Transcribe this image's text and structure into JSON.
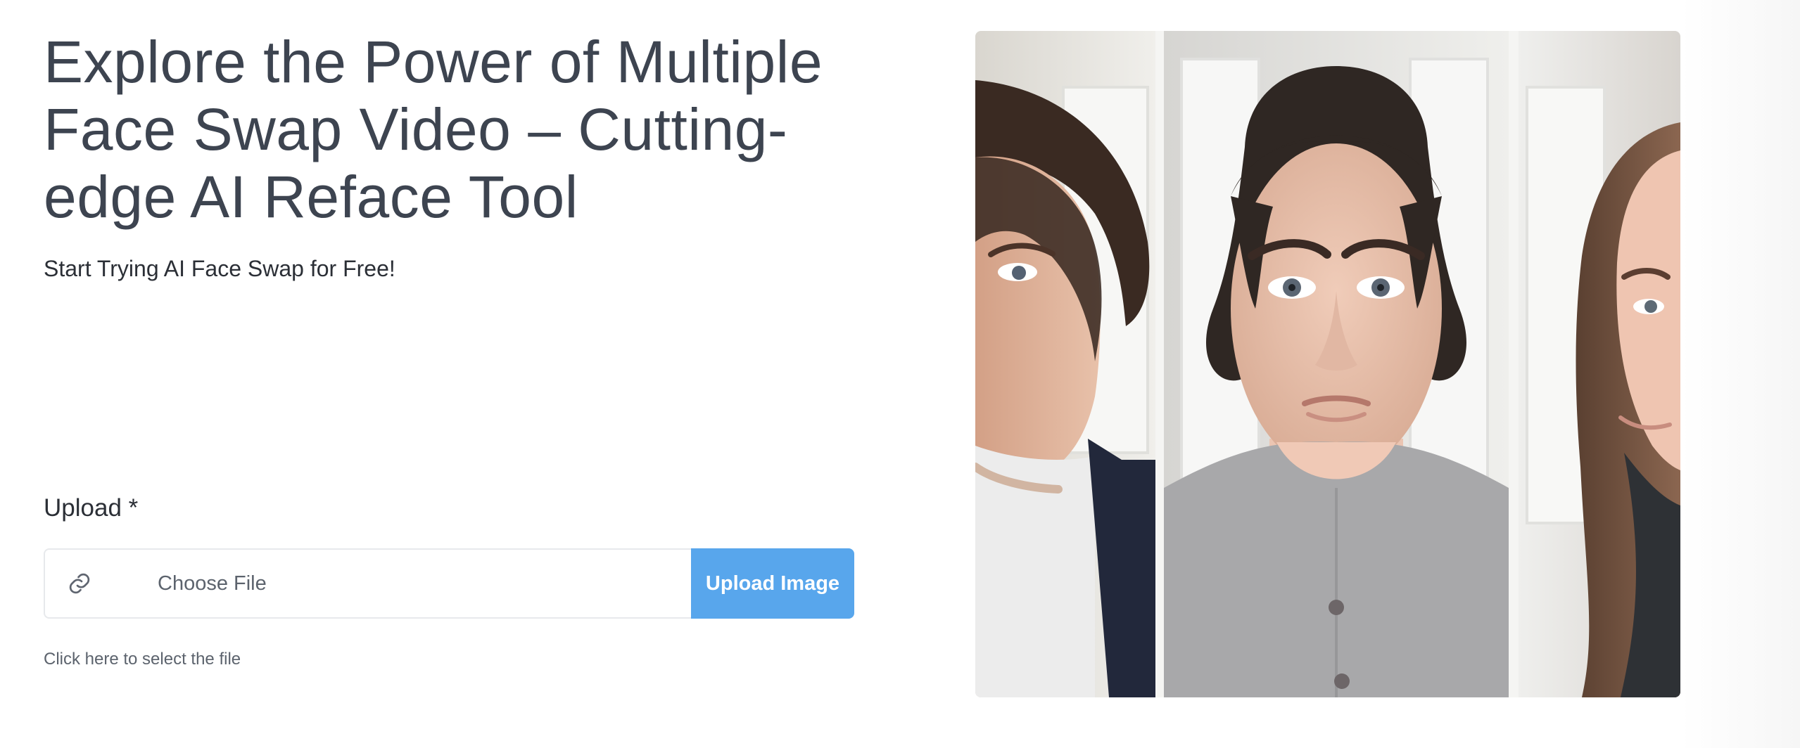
{
  "hero": {
    "title": "Explore the Power of Multiple Face Swap Video – Cutting-edge AI Reface Tool",
    "subtitle": "Start Trying AI Face Swap for Free!"
  },
  "upload": {
    "label": "Upload *",
    "file_placeholder": "Choose File",
    "button_label": "Upload Image",
    "helper_text": "Click here to select the file",
    "icon": "link-icon"
  },
  "gallery": {
    "panels": [
      "left-face-photo",
      "center-face-photo",
      "right-face-photo"
    ]
  },
  "colors": {
    "accent": "#58a6ec",
    "title": "#3d4450",
    "border": "#e7e9ec"
  }
}
